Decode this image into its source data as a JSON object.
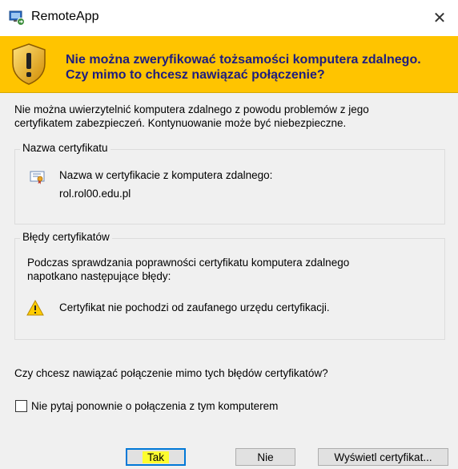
{
  "window": {
    "title": "RemoteApp",
    "close_glyph": "✕",
    "icon": "remoteapp-icon"
  },
  "banner": {
    "icon": "warning-shield-icon",
    "color": "#ffc400",
    "line1": "Nie można zweryfikować tożsamości komputera zdalnego.",
    "line2": "Czy mimo to chcesz nawiązać połączenie?"
  },
  "intro": {
    "line1": "Nie można uwierzytelnić komputera zdalnego z powodu problemów z jego",
    "line2": "certyfikatem zabezpieczeń. Kontynuowanie może być niebezpieczne."
  },
  "cert_name_group": {
    "label": "Nazwa certyfikatu",
    "icon": "certificate-icon",
    "line1": "Nazwa w certyfikacie z komputera zdalnego:",
    "value": "rol.rol00.edu.pl"
  },
  "cert_errors_group": {
    "label": "Błędy certyfikatów",
    "desc_line1": "Podczas sprawdzania poprawności certyfikatu komputera zdalnego",
    "desc_line2": "napotkano następujące błędy:",
    "icon": "warning-icon",
    "error": "Certyfikat nie pochodzi od zaufanego urzędu certyfikacji."
  },
  "question": "Czy chcesz nawiązać połączenie mimo tych błędów certyfikatów?",
  "checkbox": {
    "label": "Nie pytaj ponownie o połączenia z tym komputerem",
    "checked": false
  },
  "buttons": {
    "yes": "Tak",
    "no": "Nie",
    "view_cert": "Wyświetl certyfikat..."
  }
}
